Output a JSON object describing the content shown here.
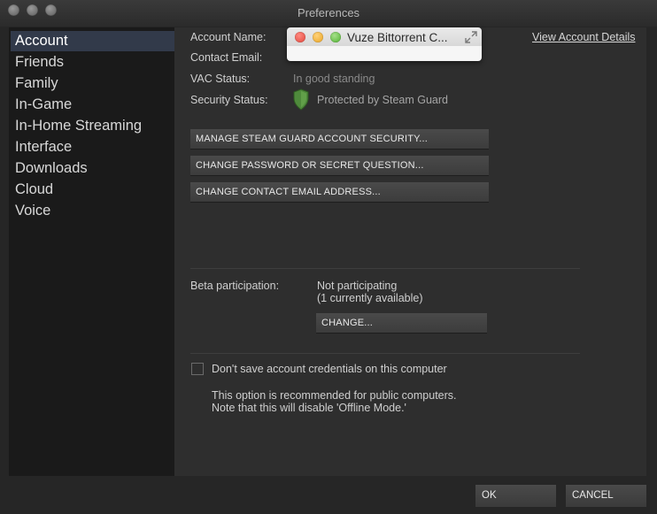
{
  "window": {
    "title": "Preferences"
  },
  "sidebar": {
    "items": [
      {
        "label": "Account"
      },
      {
        "label": "Friends"
      },
      {
        "label": "Family"
      },
      {
        "label": "In-Game"
      },
      {
        "label": "In-Home Streaming"
      },
      {
        "label": "Interface"
      },
      {
        "label": "Downloads"
      },
      {
        "label": "Cloud"
      },
      {
        "label": "Voice"
      }
    ],
    "active": "Account"
  },
  "account": {
    "name_label": "Account Name:",
    "email_label": "Contact Email:",
    "vac_label": "VAC Status:",
    "vac_value": "In good standing",
    "security_label": "Security Status:",
    "security_value": "Protected by Steam Guard",
    "view_details_link": "View Account Details",
    "buttons": {
      "manage_guard": "MANAGE STEAM GUARD ACCOUNT SECURITY...",
      "change_password": "CHANGE PASSWORD OR SECRET QUESTION...",
      "change_email": "CHANGE CONTACT EMAIL ADDRESS..."
    }
  },
  "beta": {
    "label": "Beta participation:",
    "value_line1": "Not participating",
    "value_line2": "(1 currently available)",
    "change_button": "CHANGE..."
  },
  "credentials": {
    "checkbox_label": "Don't save account credentials on this computer",
    "checked": false,
    "note_line1": "This option is recommended for public computers.",
    "note_line2": "Note that this will disable 'Offline Mode.'"
  },
  "popup": {
    "title": "Vuze Bittorrent C..."
  },
  "footer": {
    "ok": "OK",
    "cancel": "CANCEL"
  },
  "colors": {
    "sidebar_selected": "#323a4a",
    "shield_green": "#4f8a3c"
  }
}
